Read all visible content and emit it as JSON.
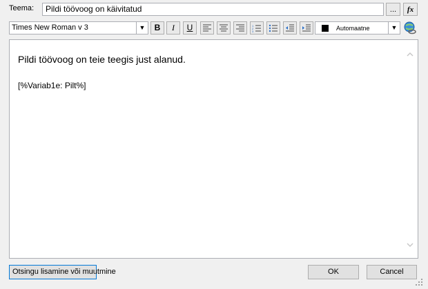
{
  "subject": {
    "label": "Teema:",
    "value": "Pildi töövoog on käivitatud",
    "browse_label": "...",
    "function_label": "fx"
  },
  "toolbar": {
    "font_value": "Times New Roman v 3",
    "bold_icon": "bold-icon",
    "italic_icon": "italic-icon",
    "underline_icon": "underline-icon",
    "color_value": "Automaatne",
    "color_hex": "#000000"
  },
  "editor": {
    "line1": "Pildi töövoog on teie teegis just alanud.",
    "line2": "[%Variab1e: Pilt%]"
  },
  "buttons": {
    "insert_lookup": "Otsingu lisamine või muutmine",
    "ok": "OK",
    "cancel": "Cancel"
  }
}
